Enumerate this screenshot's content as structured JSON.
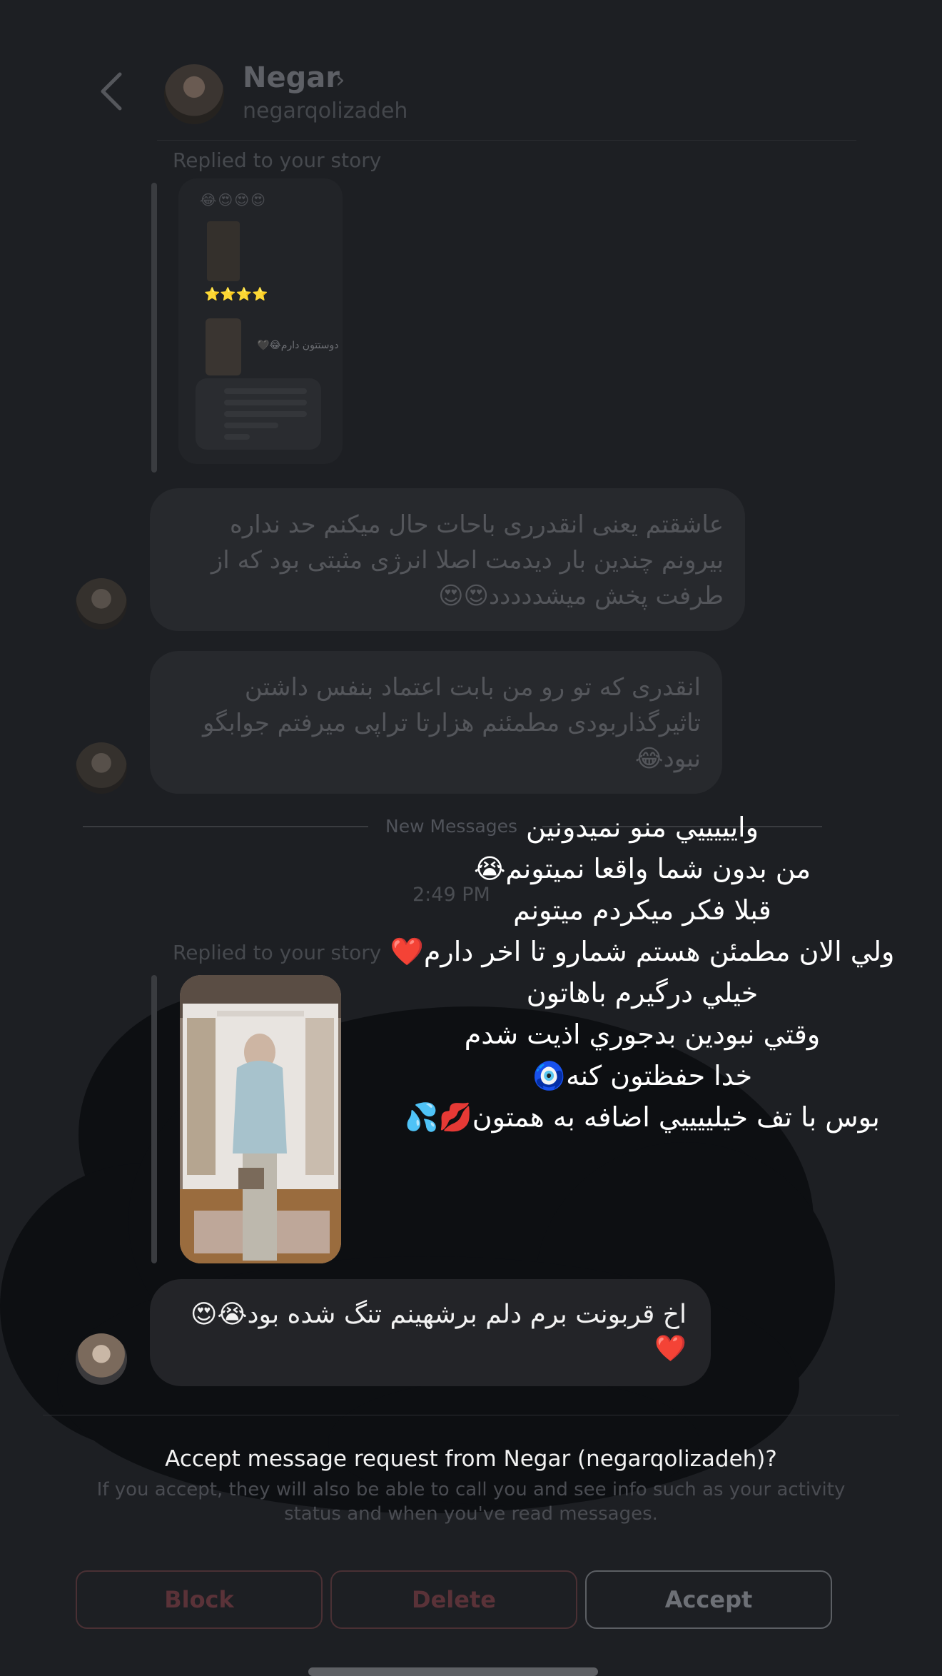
{
  "header": {
    "contact_name": "Negar",
    "contact_handle": "negarqolizadeh",
    "chevron": "›"
  },
  "thread": {
    "replied_label_1": "Replied to your story",
    "story1_emojis": "😂😍😍😍",
    "story1_stars": "⭐⭐⭐⭐",
    "story1_caption": "دوستتون دارم😂🖤",
    "message_1": "عاشقتم یعنی انقدرری باحات حال میکنم حد نداره بیرونم چندین بار دیدمت اصلا انرژی مثبتی بود که از طرفت پخش میشددددد😍😍",
    "message_2": "انقدری که تو رو من بابت اعتماد بنفس داشتن تاثیرگذاربودی مطمئنم هزارتا تراپی میرفتم جوابگو نبود😂",
    "new_messages_label": "New Messages",
    "timestamp": "2:49 PM",
    "replied_label_2": "Replied to your story",
    "message_3": "اخ قربونت برم دلم برشهینم تنگ شده بود😭😍❤️"
  },
  "overlay_text": [
    "وايييييي منو نميدونين",
    "من بدون شما واقعا نميتونم😭",
    "قبلا فكر ميكردم ميتونم",
    "ولي الان مطمئن هستم شمارو تا اخر دارم❤️",
    "خيلي درگيرم باهاتون",
    "وقتي نبودين بدجوري اذيت شدم",
    "خدا حفظتون كنه🧿",
    "بوس با تف خيلييييي اضافه به همتون💋💦"
  ],
  "request": {
    "title": "Accept message request from Negar (negarqolizadeh)?",
    "description": "If you accept, they will also be able to call you and see info such as your activity status and when you've read messages.",
    "block_label": "Block",
    "delete_label": "Delete",
    "accept_label": "Accept"
  },
  "colors": {
    "background": "#1d1f23",
    "block_delete_text": "#5a3238",
    "accept_text": "#6d7076"
  },
  "icons": [
    "back-chevron-icon",
    "profile-chevron-icon"
  ]
}
